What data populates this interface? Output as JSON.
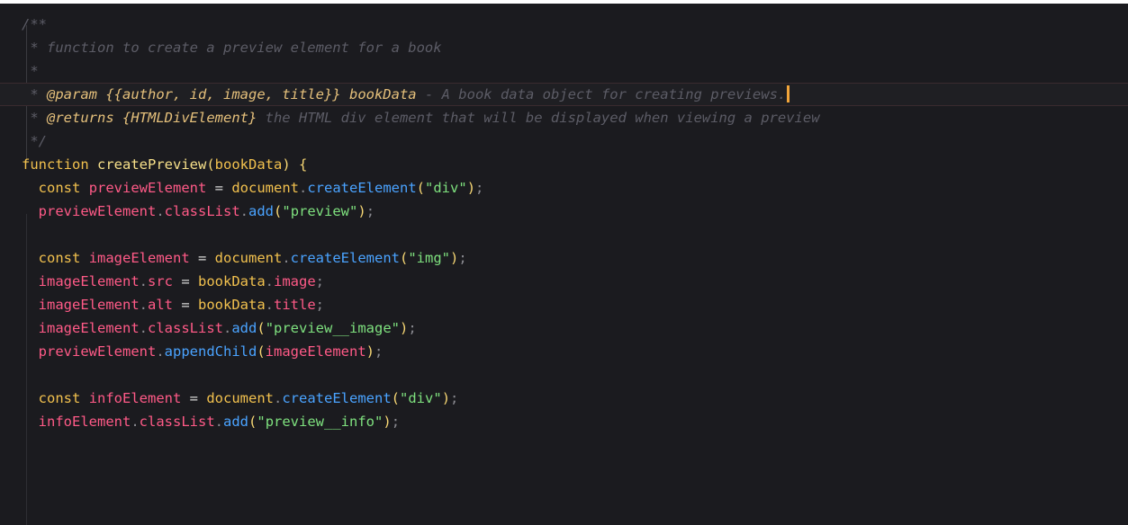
{
  "editor": {
    "lines": [
      [
        {
          "t": "comment",
          "v": "/**"
        }
      ],
      [
        {
          "t": "comment",
          "v": " * function to create a preview element for a book"
        }
      ],
      [
        {
          "t": "comment",
          "v": " *"
        }
      ],
      [
        {
          "t": "comment",
          "v": " * "
        },
        {
          "t": "tag",
          "v": "@param"
        },
        {
          "t": "comment",
          "v": " "
        },
        {
          "t": "brace",
          "v": "{{author, id, image, title}}"
        },
        {
          "t": "comment",
          "v": " "
        },
        {
          "t": "param",
          "v": "bookData"
        },
        {
          "t": "comment",
          "v": " - A book data object for creating previews."
        }
      ],
      [
        {
          "t": "comment",
          "v": " * "
        },
        {
          "t": "tag",
          "v": "@returns"
        },
        {
          "t": "comment",
          "v": " "
        },
        {
          "t": "brace",
          "v": "{HTMLDivElement}"
        },
        {
          "t": "comment",
          "v": " the HTML div element that will be displayed when viewing a preview"
        }
      ],
      [
        {
          "t": "comment",
          "v": " */"
        }
      ],
      [
        {
          "t": "keyword",
          "v": "function"
        },
        {
          "t": "op",
          "v": " "
        },
        {
          "t": "fn",
          "v": "createPreview"
        },
        {
          "t": "paren",
          "v": "("
        },
        {
          "t": "obj",
          "v": "bookData"
        },
        {
          "t": "paren",
          "v": ")"
        },
        {
          "t": "op",
          "v": " "
        },
        {
          "t": "paren",
          "v": "{"
        }
      ],
      [
        {
          "t": "op",
          "v": "  "
        },
        {
          "t": "keyword",
          "v": "const"
        },
        {
          "t": "op",
          "v": " "
        },
        {
          "t": "var",
          "v": "previewElement"
        },
        {
          "t": "op",
          "v": " = "
        },
        {
          "t": "obj",
          "v": "document"
        },
        {
          "t": "punc",
          "v": "."
        },
        {
          "t": "method",
          "v": "createElement"
        },
        {
          "t": "paren",
          "v": "("
        },
        {
          "t": "string",
          "v": "\"div\""
        },
        {
          "t": "paren",
          "v": ")"
        },
        {
          "t": "punc",
          "v": ";"
        }
      ],
      [
        {
          "t": "op",
          "v": "  "
        },
        {
          "t": "var",
          "v": "previewElement"
        },
        {
          "t": "punc",
          "v": "."
        },
        {
          "t": "prop",
          "v": "classList"
        },
        {
          "t": "punc",
          "v": "."
        },
        {
          "t": "method",
          "v": "add"
        },
        {
          "t": "paren",
          "v": "("
        },
        {
          "t": "string",
          "v": "\"preview\""
        },
        {
          "t": "paren",
          "v": ")"
        },
        {
          "t": "punc",
          "v": ";"
        }
      ],
      [],
      [
        {
          "t": "op",
          "v": "  "
        },
        {
          "t": "keyword",
          "v": "const"
        },
        {
          "t": "op",
          "v": " "
        },
        {
          "t": "var",
          "v": "imageElement"
        },
        {
          "t": "op",
          "v": " = "
        },
        {
          "t": "obj",
          "v": "document"
        },
        {
          "t": "punc",
          "v": "."
        },
        {
          "t": "method",
          "v": "createElement"
        },
        {
          "t": "paren",
          "v": "("
        },
        {
          "t": "string",
          "v": "\"img\""
        },
        {
          "t": "paren",
          "v": ")"
        },
        {
          "t": "punc",
          "v": ";"
        }
      ],
      [
        {
          "t": "op",
          "v": "  "
        },
        {
          "t": "var",
          "v": "imageElement"
        },
        {
          "t": "punc",
          "v": "."
        },
        {
          "t": "prop",
          "v": "src"
        },
        {
          "t": "op",
          "v": " = "
        },
        {
          "t": "obj",
          "v": "bookData"
        },
        {
          "t": "punc",
          "v": "."
        },
        {
          "t": "prop",
          "v": "image"
        },
        {
          "t": "punc",
          "v": ";"
        }
      ],
      [
        {
          "t": "op",
          "v": "  "
        },
        {
          "t": "var",
          "v": "imageElement"
        },
        {
          "t": "punc",
          "v": "."
        },
        {
          "t": "prop",
          "v": "alt"
        },
        {
          "t": "op",
          "v": " = "
        },
        {
          "t": "obj",
          "v": "bookData"
        },
        {
          "t": "punc",
          "v": "."
        },
        {
          "t": "prop",
          "v": "title"
        },
        {
          "t": "punc",
          "v": ";"
        }
      ],
      [
        {
          "t": "op",
          "v": "  "
        },
        {
          "t": "var",
          "v": "imageElement"
        },
        {
          "t": "punc",
          "v": "."
        },
        {
          "t": "prop",
          "v": "classList"
        },
        {
          "t": "punc",
          "v": "."
        },
        {
          "t": "method",
          "v": "add"
        },
        {
          "t": "paren",
          "v": "("
        },
        {
          "t": "string",
          "v": "\"preview__image\""
        },
        {
          "t": "paren",
          "v": ")"
        },
        {
          "t": "punc",
          "v": ";"
        }
      ],
      [
        {
          "t": "op",
          "v": "  "
        },
        {
          "t": "var",
          "v": "previewElement"
        },
        {
          "t": "punc",
          "v": "."
        },
        {
          "t": "method",
          "v": "appendChild"
        },
        {
          "t": "paren",
          "v": "("
        },
        {
          "t": "var",
          "v": "imageElement"
        },
        {
          "t": "paren",
          "v": ")"
        },
        {
          "t": "punc",
          "v": ";"
        }
      ],
      [],
      [
        {
          "t": "op",
          "v": "  "
        },
        {
          "t": "keyword",
          "v": "const"
        },
        {
          "t": "op",
          "v": " "
        },
        {
          "t": "var",
          "v": "infoElement"
        },
        {
          "t": "op",
          "v": " = "
        },
        {
          "t": "obj",
          "v": "document"
        },
        {
          "t": "punc",
          "v": "."
        },
        {
          "t": "method",
          "v": "createElement"
        },
        {
          "t": "paren",
          "v": "("
        },
        {
          "t": "string",
          "v": "\"div\""
        },
        {
          "t": "paren",
          "v": ")"
        },
        {
          "t": "punc",
          "v": ";"
        }
      ],
      [
        {
          "t": "op",
          "v": "  "
        },
        {
          "t": "var",
          "v": "infoElement"
        },
        {
          "t": "punc",
          "v": "."
        },
        {
          "t": "prop",
          "v": "classList"
        },
        {
          "t": "punc",
          "v": "."
        },
        {
          "t": "method",
          "v": "add"
        },
        {
          "t": "paren",
          "v": "("
        },
        {
          "t": "string",
          "v": "\"preview__info\""
        },
        {
          "t": "paren",
          "v": ")"
        },
        {
          "t": "punc",
          "v": ";"
        }
      ]
    ],
    "active_line": 3,
    "colors": {
      "background": "#1b1b1f",
      "comment": "#5c5c66",
      "keyword": "#f2c14e",
      "variable": "#ff5a87",
      "method": "#4aa3ff",
      "string": "#7ee07e",
      "cursor": "#f2a53a"
    }
  }
}
